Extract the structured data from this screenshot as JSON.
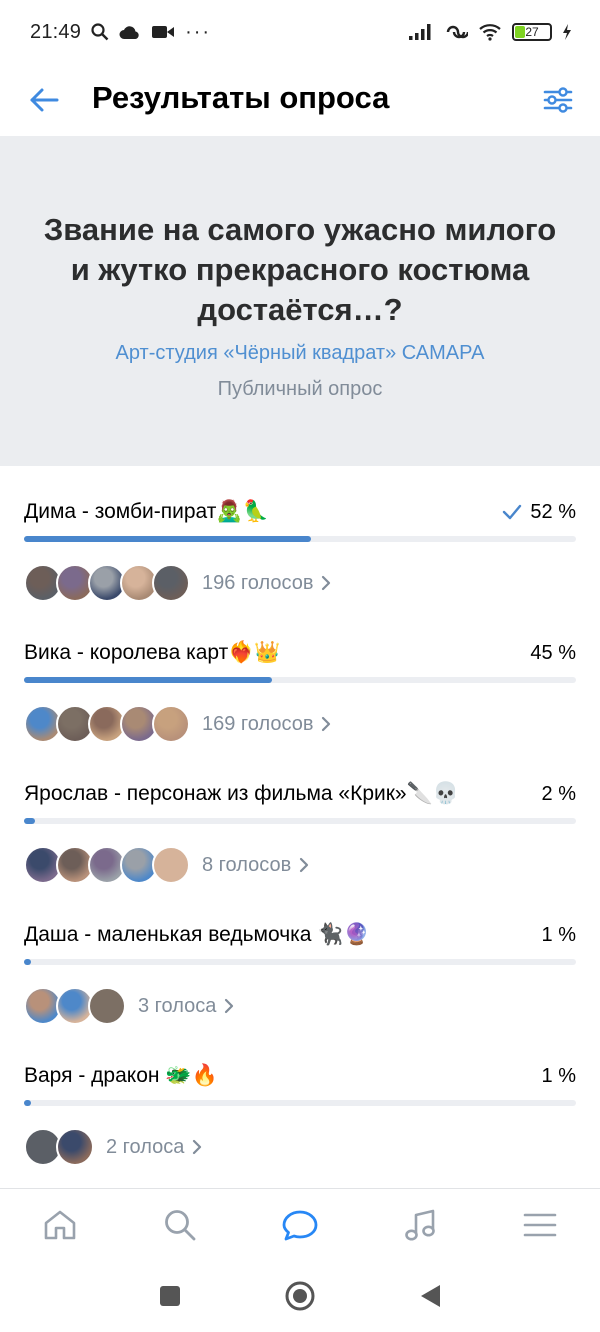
{
  "status": {
    "time": "21:49",
    "battery": "27",
    "battery_level": 0.27,
    "left_icons": [
      "search-icon",
      "cloud-icon",
      "video-icon",
      "more-icon"
    ],
    "right_icons": [
      "signal-icon",
      "hotspot-icon",
      "wifi-icon",
      "battery-icon",
      "charging-icon"
    ]
  },
  "header": {
    "title": "Результаты опроса",
    "back_icon": "arrow-left-icon",
    "filter_icon": "sliders-icon"
  },
  "poll": {
    "question": "Звание на самого ужасно милого и жутко прекрасного костюма достаётся…?",
    "author": "Арт-студия «Чёрный квадрат» САМАРА",
    "type": "Публичный опрос"
  },
  "options": [
    {
      "label": "Дима - зомби-пират🧟‍♂️🦜",
      "percent": "52 %",
      "fraction": 0.52,
      "votes": "196 голосов",
      "checked": true,
      "avatar_count": 5
    },
    {
      "label": "Вика - королева карт❤️‍🔥👑",
      "percent": "45 %",
      "fraction": 0.45,
      "votes": "169 голосов",
      "checked": false,
      "avatar_count": 5
    },
    {
      "label": "Ярослав - персонаж из фильма «Крик»🔪💀",
      "percent": "2 %",
      "fraction": 0.02,
      "votes": "8 голосов",
      "checked": false,
      "avatar_count": 5
    },
    {
      "label": "Даша - маленькая ведьмочка 🐈‍⬛🔮",
      "percent": "1 %",
      "fraction": 0.01,
      "votes": "3 голоса",
      "checked": false,
      "avatar_count": 3
    },
    {
      "label": "Варя - дракон 🐲🔥",
      "percent": "1 %",
      "fraction": 0.01,
      "votes": "2 голоса",
      "checked": false,
      "avatar_count": 2
    }
  ],
  "colors": {
    "accent": "#4986cc",
    "link": "#4f8fd1",
    "secondary_text": "#818c99",
    "question_bg": "#ebedf0",
    "track": "#eceef2"
  },
  "tabbar": [
    "home-icon",
    "search-icon",
    "messages-icon",
    "music-icon",
    "menu-icon"
  ],
  "sysnav": [
    "recents-icon",
    "home-circle-icon",
    "back-triangle-icon"
  ]
}
